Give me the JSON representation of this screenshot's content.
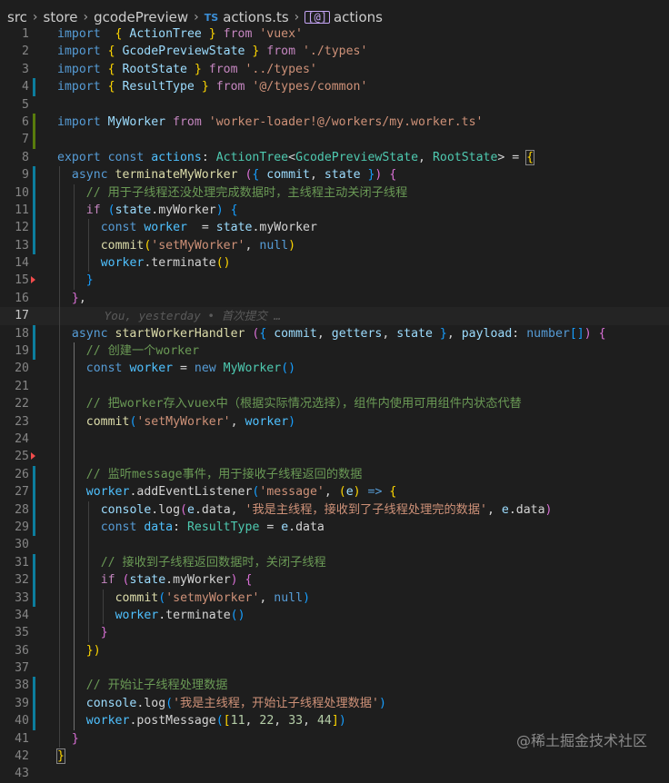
{
  "breadcrumb": {
    "src": "src",
    "store": "store",
    "folder": "gcodePreview",
    "file_icon": "TS",
    "file": "actions.ts",
    "symbol_icon": "[@]",
    "symbol": "actions"
  },
  "blame": {
    "text": "You, yesterday • 首次提交 …"
  },
  "watermark": "@稀土掘金技术社区",
  "colors": {
    "background": "#1e1e1e",
    "keyword": "#569cd6",
    "control": "#c586c0",
    "string": "#ce9178",
    "type": "#4ec9b0",
    "function": "#dcdcaa",
    "variable": "#9cdcfe",
    "comment": "#6a9955"
  },
  "lines": [
    {
      "n": "1",
      "tokens": [
        [
          "kw",
          "import"
        ],
        [
          "",
          "  "
        ],
        [
          "brk1",
          "{"
        ],
        [
          "var",
          " ActionTree "
        ],
        [
          "brk1",
          "}"
        ],
        [
          "ctl",
          " from "
        ],
        [
          "str",
          "'vuex'"
        ]
      ]
    },
    {
      "n": "2",
      "tokens": [
        [
          "kw",
          "import"
        ],
        [
          "",
          ""
        ],
        [
          "brk1",
          " {"
        ],
        [
          "var",
          " GcodePreviewState "
        ],
        [
          "brk1",
          "}"
        ],
        [
          "ctl",
          " from "
        ],
        [
          "str",
          "'./types'"
        ]
      ]
    },
    {
      "n": "3",
      "tokens": [
        [
          "kw",
          "import"
        ],
        [
          "brk1",
          " {"
        ],
        [
          "var",
          " RootState "
        ],
        [
          "brk1",
          "}"
        ],
        [
          "ctl",
          " from "
        ],
        [
          "str",
          "'../types'"
        ]
      ]
    },
    {
      "n": "4",
      "tokens": [
        [
          "kw",
          "import"
        ],
        [
          "brk1",
          " {"
        ],
        [
          "var",
          " ResultType "
        ],
        [
          "brk1",
          "}"
        ],
        [
          "ctl",
          " from "
        ],
        [
          "str",
          "'@/types/common'"
        ]
      ]
    },
    {
      "n": "5",
      "tokens": []
    },
    {
      "n": "6",
      "tokens": [
        [
          "kw",
          "import"
        ],
        [
          "var",
          " MyWorker"
        ],
        [
          "ctl",
          " from "
        ],
        [
          "str",
          "'worker-loader!@/workers/my.worker.ts'"
        ]
      ]
    },
    {
      "n": "7",
      "tokens": []
    },
    {
      "n": "8",
      "tokens": [
        [
          "kw",
          "export"
        ],
        [
          "kw",
          " const"
        ],
        [
          "const",
          " actions"
        ],
        [
          "",
          ": "
        ],
        [
          "typ",
          "ActionTree"
        ],
        [
          "",
          "<"
        ],
        [
          "typ",
          "GcodePreviewState"
        ],
        [
          "",
          ", "
        ],
        [
          "typ",
          "RootState"
        ],
        [
          "",
          "> = "
        ],
        [
          "brk1 pbox",
          "{"
        ]
      ]
    },
    {
      "n": "9",
      "tokens": [
        [
          "kw",
          "async"
        ],
        [
          "fn",
          " terminateMyWorker"
        ],
        [
          "brk2",
          " ("
        ],
        [
          "brk3",
          "{"
        ],
        [
          "var",
          " commit"
        ],
        [
          "",
          ", "
        ],
        [
          "var",
          "state"
        ],
        [
          "brk3",
          " }"
        ],
        [
          "brk2",
          ")"
        ],
        [
          "brk2",
          " {"
        ]
      ]
    },
    {
      "n": "10",
      "tokens": [
        [
          "cmt",
          "// 用于子线程还没处理完成数据时，主线程主动关闭子线程"
        ]
      ]
    },
    {
      "n": "11",
      "tokens": [
        [
          "ctl",
          "if"
        ],
        [
          "brk3",
          " ("
        ],
        [
          "var",
          "state"
        ],
        [
          "",
          ".myWorker"
        ],
        [
          "brk3",
          ")"
        ],
        [
          "brk3",
          " {"
        ]
      ]
    },
    {
      "n": "12",
      "tokens": [
        [
          "kw",
          "const"
        ],
        [
          "const",
          " worker"
        ],
        [
          "",
          "",
          " "
        ],
        [
          "",
          " = "
        ],
        [
          "var",
          "state"
        ],
        [
          "",
          ".myWorker"
        ]
      ]
    },
    {
      "n": "13",
      "tokens": [
        [
          "fn",
          "commit"
        ],
        [
          "brk1",
          "("
        ],
        [
          "str",
          "'setMyWorker'"
        ],
        [
          "",
          ", "
        ],
        [
          "kw",
          "null"
        ],
        [
          "brk1",
          ")"
        ]
      ]
    },
    {
      "n": "14",
      "tokens": [
        [
          "const",
          "worker"
        ],
        [
          "",
          ".terminate"
        ],
        [
          "brk1",
          "()"
        ]
      ]
    },
    {
      "n": "15",
      "tokens": [
        [
          "brk3",
          "}"
        ]
      ]
    },
    {
      "n": "16",
      "tokens": [
        [
          "brk2",
          "}"
        ],
        [
          "",
          ","
        ]
      ]
    },
    {
      "n": "17",
      "tokens": []
    },
    {
      "n": "18",
      "tokens": [
        [
          "kw",
          "async"
        ],
        [
          "fn",
          " startWorkerHandler"
        ],
        [
          "brk2",
          " ("
        ],
        [
          "brk3",
          "{"
        ],
        [
          "var",
          " commit"
        ],
        [
          "",
          ", "
        ],
        [
          "var",
          "getters"
        ],
        [
          "",
          ", "
        ],
        [
          "var",
          "state"
        ],
        [
          "brk3",
          " }"
        ],
        [
          "",
          ", "
        ],
        [
          "var",
          "payload"
        ],
        [
          "",
          ": "
        ],
        [
          "kw",
          "number"
        ],
        [
          "brk3",
          "[]"
        ],
        [
          "brk2",
          ")"
        ],
        [
          "brk2",
          " {"
        ]
      ]
    },
    {
      "n": "19",
      "tokens": [
        [
          "cmt",
          "// 创建一个worker"
        ]
      ]
    },
    {
      "n": "20",
      "tokens": [
        [
          "kw",
          "const"
        ],
        [
          "const",
          " worker"
        ],
        [
          "",
          " = "
        ],
        [
          "kw",
          "new"
        ],
        [
          "typ",
          " MyWorker"
        ],
        [
          "brk3",
          "()"
        ]
      ]
    },
    {
      "n": "21",
      "tokens": []
    },
    {
      "n": "22",
      "tokens": [
        [
          "cmt",
          "// 把worker存入vuex中（根据实际情况选择），组件内使用可用组件内状态代替"
        ]
      ]
    },
    {
      "n": "23",
      "tokens": [
        [
          "fn",
          "commit"
        ],
        [
          "brk3",
          "("
        ],
        [
          "str",
          "'setMyWorker'"
        ],
        [
          "",
          ", "
        ],
        [
          "const",
          "worker"
        ],
        [
          "brk3",
          ")"
        ]
      ]
    },
    {
      "n": "24",
      "tokens": []
    },
    {
      "n": "25",
      "tokens": []
    },
    {
      "n": "26",
      "tokens": [
        [
          "cmt",
          "// 监听message事件，用于接收子线程返回的数据"
        ]
      ]
    },
    {
      "n": "27",
      "tokens": [
        [
          "const",
          "worker"
        ],
        [
          "",
          ".addEventListener"
        ],
        [
          "brk3",
          "("
        ],
        [
          "str",
          "'message'"
        ],
        [
          "",
          ", "
        ],
        [
          "brk1",
          "("
        ],
        [
          "var",
          "e"
        ],
        [
          "brk1",
          ")"
        ],
        [
          "kw",
          " =>"
        ],
        [
          "brk1",
          " {"
        ]
      ]
    },
    {
      "n": "28",
      "tokens": [
        [
          "var",
          "console"
        ],
        [
          "",
          ".log"
        ],
        [
          "brk2",
          "("
        ],
        [
          "var",
          "e"
        ],
        [
          "",
          ".data"
        ],
        [
          "",
          ", "
        ],
        [
          "str",
          "'我是主线程，接收到了子线程处理完的数据'"
        ],
        [
          "",
          ", "
        ],
        [
          "var",
          "e"
        ],
        [
          "",
          ".data"
        ],
        [
          "brk2",
          ")"
        ]
      ]
    },
    {
      "n": "29",
      "tokens": [
        [
          "kw",
          "const"
        ],
        [
          "const",
          " data"
        ],
        [
          "",
          ": "
        ],
        [
          "typ",
          "ResultType"
        ],
        [
          "",
          " = "
        ],
        [
          "var",
          "e"
        ],
        [
          "",
          ".data"
        ]
      ]
    },
    {
      "n": "30",
      "tokens": []
    },
    {
      "n": "31",
      "tokens": [
        [
          "cmt",
          "// 接收到子线程返回数据时，关闭子线程"
        ]
      ]
    },
    {
      "n": "32",
      "tokens": [
        [
          "ctl",
          "if"
        ],
        [
          "brk2",
          " ("
        ],
        [
          "var",
          "state"
        ],
        [
          "",
          ".myWorker"
        ],
        [
          "brk2",
          ")"
        ],
        [
          "brk2",
          " {"
        ]
      ]
    },
    {
      "n": "33",
      "tokens": [
        [
          "fn",
          "commit"
        ],
        [
          "brk3",
          "("
        ],
        [
          "str",
          "'setmyWorker'"
        ],
        [
          "",
          ", "
        ],
        [
          "kw",
          "null"
        ],
        [
          "brk3",
          ")"
        ]
      ]
    },
    {
      "n": "34",
      "tokens": [
        [
          "const",
          "worker"
        ],
        [
          "",
          ".terminate"
        ],
        [
          "brk3",
          "()"
        ]
      ]
    },
    {
      "n": "35",
      "tokens": [
        [
          "brk2",
          "}"
        ]
      ]
    },
    {
      "n": "36",
      "tokens": [
        [
          "brk1",
          "})"
        ]
      ]
    },
    {
      "n": "37",
      "tokens": []
    },
    {
      "n": "38",
      "tokens": [
        [
          "cmt",
          "// 开始让子线程处理数据"
        ]
      ]
    },
    {
      "n": "39",
      "tokens": [
        [
          "var",
          "console"
        ],
        [
          "",
          ".log"
        ],
        [
          "brk3",
          "("
        ],
        [
          "str",
          "'我是主线程，开始让子线程处理数据'"
        ],
        [
          "brk3",
          ")"
        ]
      ]
    },
    {
      "n": "40",
      "tokens": [
        [
          "const",
          "worker"
        ],
        [
          "",
          ".postMessage"
        ],
        [
          "brk3",
          "("
        ],
        [
          "brk1",
          "["
        ],
        [
          "num",
          "11"
        ],
        [
          "",
          ", "
        ],
        [
          "num",
          "22"
        ],
        [
          "",
          ", "
        ],
        [
          "num",
          "33"
        ],
        [
          "",
          ", "
        ],
        [
          "num",
          "44"
        ],
        [
          "brk1",
          "]"
        ],
        [
          "brk3",
          ")"
        ]
      ]
    },
    {
      "n": "41",
      "tokens": [
        [
          "brk2",
          "}"
        ]
      ]
    },
    {
      "n": "42",
      "tokens": [
        [
          "brk1 pbox",
          "}"
        ]
      ]
    },
    {
      "n": "43",
      "tokens": []
    }
  ]
}
